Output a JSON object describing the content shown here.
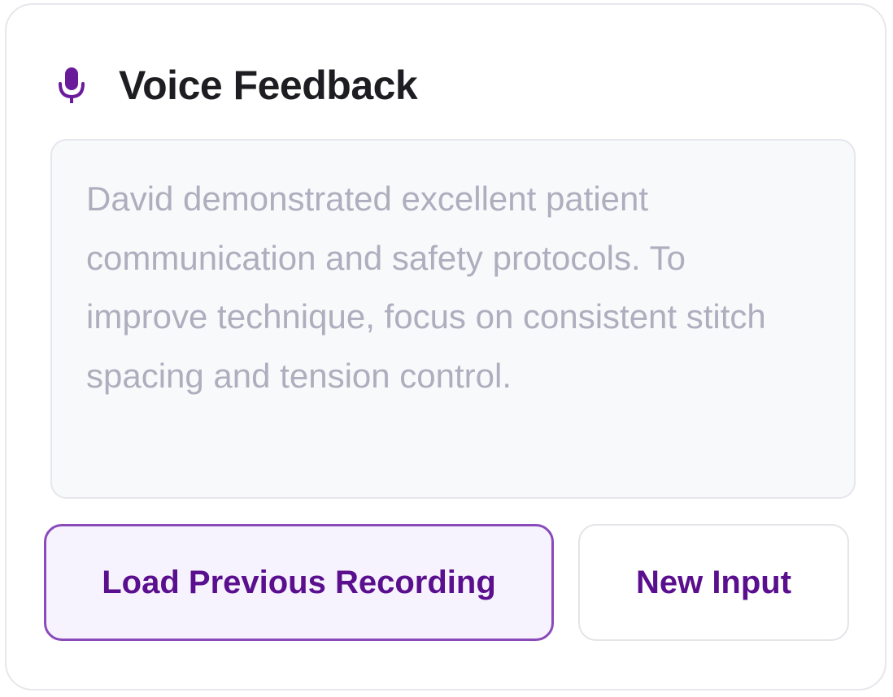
{
  "card": {
    "title": "Voice Feedback",
    "icon": "microphone-icon"
  },
  "feedback": {
    "text": "David demonstrated excellent patient communication and safety protocols. To improve technique, focus on consistent stitch spacing and tension control."
  },
  "actions": {
    "load_label": "Load Previous Recording",
    "new_label": "New Input"
  },
  "colors": {
    "accent": "#6a1b9a",
    "button_text": "#5a0f8e",
    "primary_border": "#8a4ab9",
    "primary_bg": "#f6f3fe",
    "placeholder_text": "#aeaebe"
  }
}
